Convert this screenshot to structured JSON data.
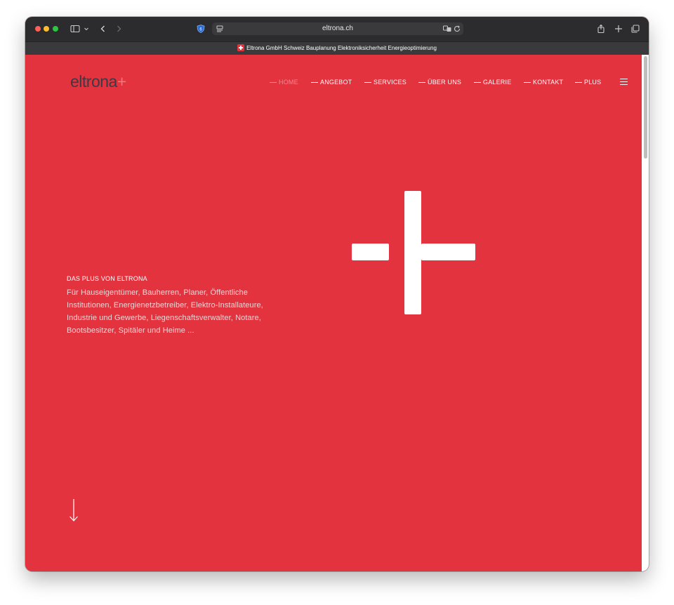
{
  "browser": {
    "url": "eltrona.ch",
    "tab_title": "Eltrona GmbH Schweiz Bauplanung Elektroniksicherheit Energieoptimierung"
  },
  "site": {
    "logo_text": "eltrona",
    "logo_plus": "+",
    "nav": [
      {
        "label": "HOME",
        "active": true
      },
      {
        "label": "ANGEBOT",
        "active": false
      },
      {
        "label": "SERVICES",
        "active": false
      },
      {
        "label": "ÜBER UNS",
        "active": false
      },
      {
        "label": "GALERIE",
        "active": false
      },
      {
        "label": "KONTAKT",
        "active": false
      },
      {
        "label": "PLUS",
        "active": false
      }
    ],
    "hero": {
      "label": "DAS PLUS VON ELTRONA",
      "text": "Für Hauseigentümer, Bauherren, Planer, Öffentliche Institutionen, Energienetzbetreiber, Elektro-Installateure, Industrie und Gewerbe, Liegenschaftsverwalter, Notare, Bootsbesitzer, Spitäler und Heime ..."
    }
  },
  "colors": {
    "brand_red": "#e3333f",
    "active_nav": "#f08a90",
    "toolbar": "#2c2c2e"
  },
  "icons": [
    "sidebar-icon",
    "chevron-down-icon",
    "back-icon",
    "forward-icon",
    "shield-icon",
    "reader-icon",
    "translate-icon",
    "reload-icon",
    "share-icon",
    "new-tab-icon",
    "tabs-overview-icon",
    "hamburger-icon",
    "down-arrow-icon"
  ]
}
